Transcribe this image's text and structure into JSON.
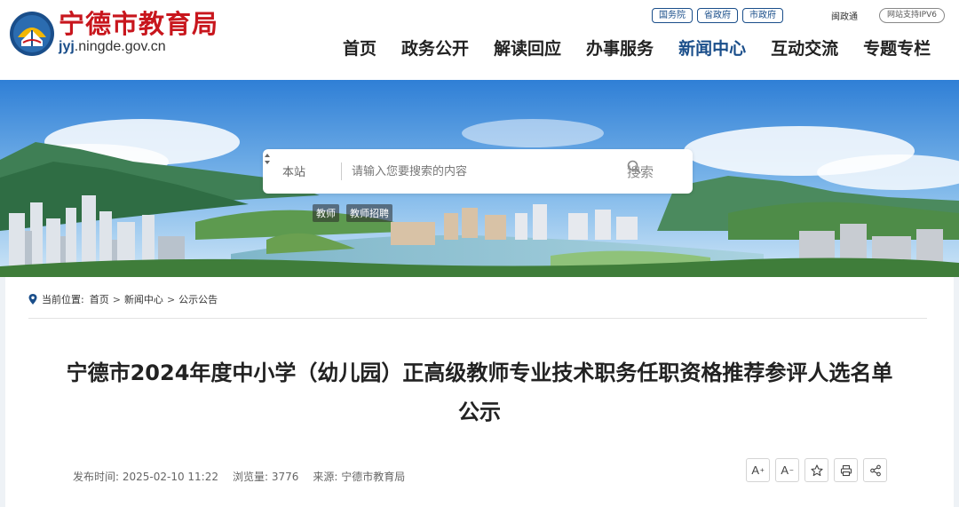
{
  "header": {
    "site_name": "宁德市教育局",
    "domain_prefix": "jyj",
    "domain_suffix": ".ningde.gov.cn",
    "top_links": [
      "国务院",
      "省政府",
      "市政府"
    ],
    "minzheng": "闽政通",
    "ipv6": "网站支持IPV6",
    "nav": [
      {
        "label": "首页",
        "active": false
      },
      {
        "label": "政务公开",
        "active": false
      },
      {
        "label": "解读回应",
        "active": false
      },
      {
        "label": "办事服务",
        "active": false
      },
      {
        "label": "新闻中心",
        "active": true
      },
      {
        "label": "互动交流",
        "active": false
      },
      {
        "label": "专题专栏",
        "active": false
      }
    ]
  },
  "search": {
    "scope": "本站",
    "placeholder": "请输入您要搜索的内容",
    "button": "搜索",
    "hot_tags": [
      "教师",
      "教师招聘"
    ]
  },
  "breadcrumb": {
    "label": "当前位置:",
    "items": [
      "首页",
      "新闻中心",
      "公示公告"
    ],
    "separator": ">"
  },
  "article": {
    "title": "宁德市2024年度中小学（幼儿园）正高级教师专业技术职务任职资格推荐参评人选名单公示",
    "published": "发布时间: 2025-02-10 11:22",
    "views": "浏览量: 3776",
    "source": "来源: 宁德市教育局"
  },
  "tools": {
    "font_larger": "A",
    "font_smaller": "A"
  },
  "colors": {
    "brand_red": "#c8161d",
    "brand_blue": "#1a4e8a"
  }
}
